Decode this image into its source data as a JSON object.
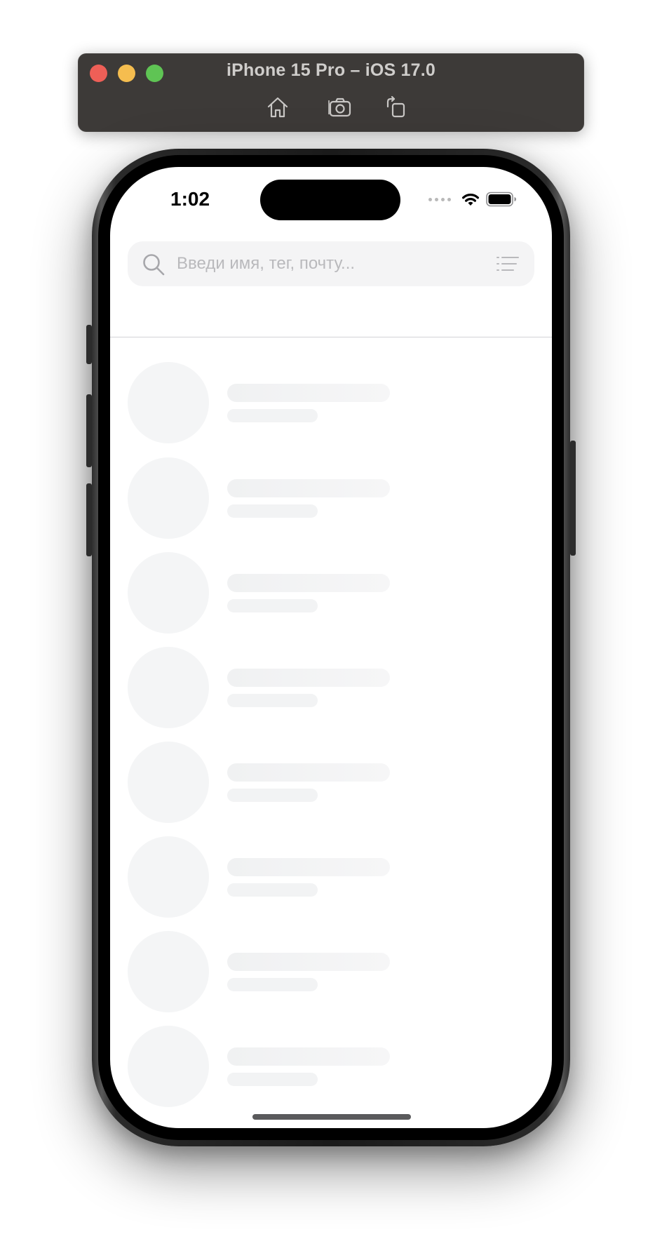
{
  "simulator": {
    "title": "iPhone 15 Pro – iOS 17.0",
    "toolbar": [
      {
        "icon": "home-icon",
        "label": "Home"
      },
      {
        "icon": "screenshot-icon",
        "label": "Screenshot"
      },
      {
        "icon": "rotate-icon",
        "label": "Rotate"
      }
    ],
    "traffic_lights": {
      "close": "#ee5f57",
      "minimize": "#f5bd4f",
      "zoom": "#5fc454"
    }
  },
  "status_bar": {
    "time": "1:02",
    "icons": [
      "cellular-dots-icon",
      "wifi-icon",
      "battery-icon"
    ]
  },
  "search": {
    "placeholder": "Введи имя, тег, почту...",
    "value": "",
    "icon": "search-icon",
    "filter_icon": "filter-icon"
  },
  "list": {
    "state": "loading",
    "skeleton_rows": 8
  },
  "colors": {
    "skeleton": "#f4f5f6",
    "search_bg": "#f4f4f5",
    "placeholder": "#b9b9bc",
    "window_bar": "#3d3a38"
  }
}
